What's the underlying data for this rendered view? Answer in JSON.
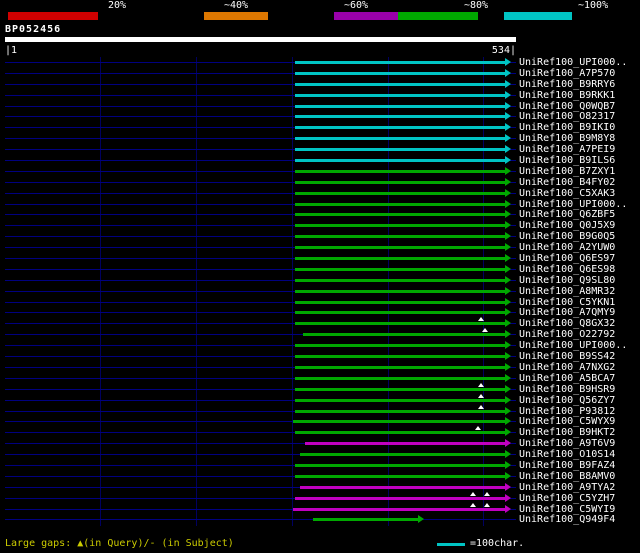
{
  "header": {
    "scale_labels": [
      "20%",
      "~40%",
      "~60%",
      "~80%",
      "~100%"
    ],
    "query_id": "BP052456",
    "ruler_start_label": "|1",
    "ruler_end_label": "534|"
  },
  "footer": {
    "gaps_note": "Large gaps: ▲(in Query)/- (in Subject)",
    "scale_legend": "=100char."
  },
  "colors": {
    "cyan": "#00C4C4",
    "green": "#00A800",
    "magenta": "#C000C0",
    "red": "#D00000",
    "orange": "#DD7700",
    "purple": "#9900AA",
    "baseline": "#000080",
    "grid": "#000060",
    "background": "#000000",
    "query_bar": "#FFFFFF",
    "gaps_note_text": "#CCCC00"
  },
  "chart_data": {
    "type": "bar",
    "subtype": "blast-alignment-overview",
    "orientation": "horizontal",
    "title": "BP052456",
    "query_id": "BP052456",
    "query_length": 534,
    "x_axis": {
      "start": 1,
      "end": 534,
      "start_label": "|1",
      "end_label": "534|"
    },
    "gridlines": [
      100,
      200,
      300,
      400,
      500
    ],
    "identity_scale": [
      {
        "label": "20%",
        "color": "#D00000"
      },
      {
        "label": "~40%",
        "color": "#DD7700"
      },
      {
        "label": "~60%",
        "color": "#9900AA"
      },
      {
        "label": "~80%",
        "color": "#00A800"
      },
      {
        "label": "~100%",
        "color": "#00C4C4"
      }
    ],
    "rows": [
      {
        "label": "UniRef100_UPI000..",
        "color": "cyan",
        "start": 304,
        "end": 523,
        "gaps": []
      },
      {
        "label": "UniRef100_A7P570",
        "color": "cyan",
        "start": 304,
        "end": 523,
        "gaps": []
      },
      {
        "label": "UniRef100_B9RRY6",
        "color": "cyan",
        "start": 304,
        "end": 523,
        "gaps": []
      },
      {
        "label": "UniRef100_B9RKK1",
        "color": "cyan",
        "start": 304,
        "end": 523,
        "gaps": []
      },
      {
        "label": "UniRef100_Q0WQB7",
        "color": "cyan",
        "start": 304,
        "end": 523,
        "gaps": []
      },
      {
        "label": "UniRef100_O82317",
        "color": "cyan",
        "start": 304,
        "end": 523,
        "gaps": []
      },
      {
        "label": "UniRef100_B9IKI0",
        "color": "cyan",
        "start": 304,
        "end": 523,
        "gaps": []
      },
      {
        "label": "UniRef100_B9M8Y8",
        "color": "cyan",
        "start": 304,
        "end": 523,
        "gaps": []
      },
      {
        "label": "UniRef100_A7PEI9",
        "color": "cyan",
        "start": 304,
        "end": 523,
        "gaps": []
      },
      {
        "label": "UniRef100_B9ILS6",
        "color": "cyan",
        "start": 304,
        "end": 523,
        "gaps": []
      },
      {
        "label": "UniRef100_B7ZXY1",
        "color": "green",
        "start": 304,
        "end": 523,
        "gaps": []
      },
      {
        "label": "UniRef100_B4FY02",
        "color": "green",
        "start": 304,
        "end": 523,
        "gaps": []
      },
      {
        "label": "UniRef100_C5XAK3",
        "color": "green",
        "start": 304,
        "end": 523,
        "gaps": []
      },
      {
        "label": "UniRef100_UPI000..",
        "color": "green",
        "start": 304,
        "end": 523,
        "gaps": []
      },
      {
        "label": "UniRef100_Q6ZBF5",
        "color": "green",
        "start": 304,
        "end": 523,
        "gaps": []
      },
      {
        "label": "UniRef100_Q0J5X9",
        "color": "green",
        "start": 304,
        "end": 523,
        "gaps": []
      },
      {
        "label": "UniRef100_B9G0Q5",
        "color": "green",
        "start": 304,
        "end": 523,
        "gaps": []
      },
      {
        "label": "UniRef100_A2YUW0",
        "color": "green",
        "start": 304,
        "end": 523,
        "gaps": []
      },
      {
        "label": "UniRef100_Q6ES97",
        "color": "green",
        "start": 304,
        "end": 523,
        "gaps": []
      },
      {
        "label": "UniRef100_Q6ES98",
        "color": "green",
        "start": 304,
        "end": 523,
        "gaps": []
      },
      {
        "label": "UniRef100_Q9SL80",
        "color": "green",
        "start": 304,
        "end": 523,
        "gaps": []
      },
      {
        "label": "UniRef100_A8MR32",
        "color": "green",
        "start": 304,
        "end": 523,
        "gaps": []
      },
      {
        "label": "UniRef100_C5YKN1",
        "color": "green",
        "start": 304,
        "end": 523,
        "gaps": []
      },
      {
        "label": "UniRef100_A7QMY9",
        "color": "green",
        "start": 304,
        "end": 523,
        "gaps": []
      },
      {
        "label": "UniRef100_Q8GX32",
        "color": "green",
        "start": 304,
        "end": 523,
        "gaps": [
          498
        ]
      },
      {
        "label": "UniRef100_O22792",
        "color": "green",
        "start": 312,
        "end": 523,
        "gaps": [
          502
        ]
      },
      {
        "label": "UniRef100_UPI000..",
        "color": "green",
        "start": 304,
        "end": 523,
        "gaps": []
      },
      {
        "label": "UniRef100_B9SS42",
        "color": "green",
        "start": 304,
        "end": 523,
        "gaps": []
      },
      {
        "label": "UniRef100_A7NXG2",
        "color": "green",
        "start": 304,
        "end": 523,
        "gaps": []
      },
      {
        "label": "UniRef100_A5BCA7",
        "color": "green",
        "start": 304,
        "end": 523,
        "gaps": []
      },
      {
        "label": "UniRef100_B9HSR9",
        "color": "green",
        "start": 304,
        "end": 523,
        "gaps": [
          497
        ]
      },
      {
        "label": "UniRef100_Q56ZY7",
        "color": "green",
        "start": 304,
        "end": 523,
        "gaps": [
          497
        ]
      },
      {
        "label": "UniRef100_P93812",
        "color": "green",
        "start": 304,
        "end": 523,
        "gaps": [
          497
        ]
      },
      {
        "label": "UniRef100_C5WYX9",
        "color": "green",
        "start": 301,
        "end": 523,
        "gaps": []
      },
      {
        "label": "UniRef100_B9HKT2",
        "color": "green",
        "start": 304,
        "end": 523,
        "gaps": [
          494
        ]
      },
      {
        "label": "UniRef100_A9T6V9",
        "color": "magenta",
        "start": 314,
        "end": 523,
        "gaps": []
      },
      {
        "label": "UniRef100_O10S14",
        "color": "green",
        "start": 309,
        "end": 523,
        "gaps": []
      },
      {
        "label": "UniRef100_B9FAZ4",
        "color": "green",
        "start": 304,
        "end": 523,
        "gaps": []
      },
      {
        "label": "UniRef100_B8AMV0",
        "color": "green",
        "start": 304,
        "end": 523,
        "gaps": []
      },
      {
        "label": "UniRef100_A9TYA2",
        "color": "magenta",
        "start": 309,
        "end": 523,
        "gaps": []
      },
      {
        "label": "UniRef100_C5YZH7",
        "color": "magenta",
        "start": 304,
        "end": 523,
        "gaps": [
          489,
          504
        ]
      },
      {
        "label": "UniRef100_C5WYI9",
        "color": "magenta",
        "start": 301,
        "end": 523,
        "gaps": [
          489,
          504
        ]
      },
      {
        "label": "UniRef100_Q949F4",
        "color": "green",
        "start": 322,
        "end": 432,
        "gaps": []
      }
    ]
  }
}
